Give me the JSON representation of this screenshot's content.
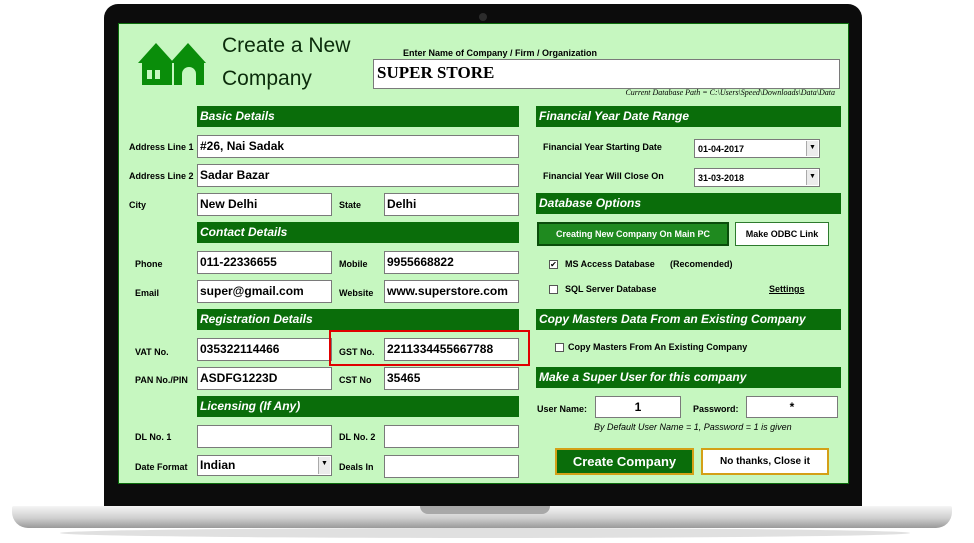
{
  "form": {
    "title_line1": "Create a New",
    "title_line2": "Company",
    "company_prompt": "Enter Name of Company / Firm / Organization",
    "company_name": "SUPER STORE",
    "db_path": "Current Database Path = C:\\Users\\Speed\\Downloads\\Data\\Data"
  },
  "basic": {
    "header": "Basic Details",
    "address1_label": "Address Line 1",
    "address1": "#26, Nai Sadak",
    "address2_label": "Address Line 2",
    "address2": "Sadar Bazar",
    "city_label": "City",
    "city": "New Delhi",
    "state_label": "State",
    "state": "Delhi"
  },
  "contact": {
    "header": "Contact Details",
    "phone_label": "Phone",
    "phone": "011-22336655",
    "mobile_label": "Mobile",
    "mobile": "9955668822",
    "email_label": "Email",
    "email": "super@gmail.com",
    "website_label": "Website",
    "website": "www.superstore.com"
  },
  "registration": {
    "header": "Registration Details",
    "vat_label": "VAT No.",
    "vat": "035322114466",
    "gst_label": "GST No.",
    "gst": "2211334455667788",
    "pan_label": "PAN No./PIN",
    "pan": "ASDFG1223D",
    "cst_label": "CST No",
    "cst": "35465"
  },
  "licensing": {
    "header": "Licensing (If Any)",
    "dl1_label": "DL No. 1",
    "dl1": "",
    "dl2_label": "DL No. 2",
    "dl2": "",
    "date_format_label": "Date Format",
    "date_format": "Indian",
    "deals_label": "Deals In",
    "deals": ""
  },
  "financial": {
    "header": "Financial Year Date Range",
    "start_label": "Financial Year Starting Date",
    "start": "01-04-2017",
    "close_label": "Financial Year Will Close On",
    "close": "31-03-2018"
  },
  "database": {
    "header": "Database Options",
    "create_main_pc": "Creating New Company On Main PC",
    "odbc": "Make ODBC Link",
    "ms_access": "MS Access Database",
    "recommended": "(Recomended)",
    "sql_server": "SQL Server Database",
    "settings": "Settings",
    "ms_access_checked": true,
    "sql_server_checked": false
  },
  "copy": {
    "header": "Copy Masters Data From an Existing Company",
    "checkbox_label": "Copy Masters From An Existing Company"
  },
  "superuser": {
    "header": "Make a Super User for this company",
    "user_label": "User Name:",
    "user": "1",
    "password_label": "Password:",
    "password": "*",
    "hint": "By Default User Name = 1,  Password = 1 is given"
  },
  "actions": {
    "create": "Create Company",
    "close": "No thanks, Close it"
  },
  "icons": {
    "logo": "house-icon",
    "dropdown": "chevron-down-icon",
    "check": "✔",
    "arrow": "▼"
  },
  "colors": {
    "accent": "#0a6d0a",
    "background": "#c6f7c0",
    "highlight": "#e00000"
  }
}
